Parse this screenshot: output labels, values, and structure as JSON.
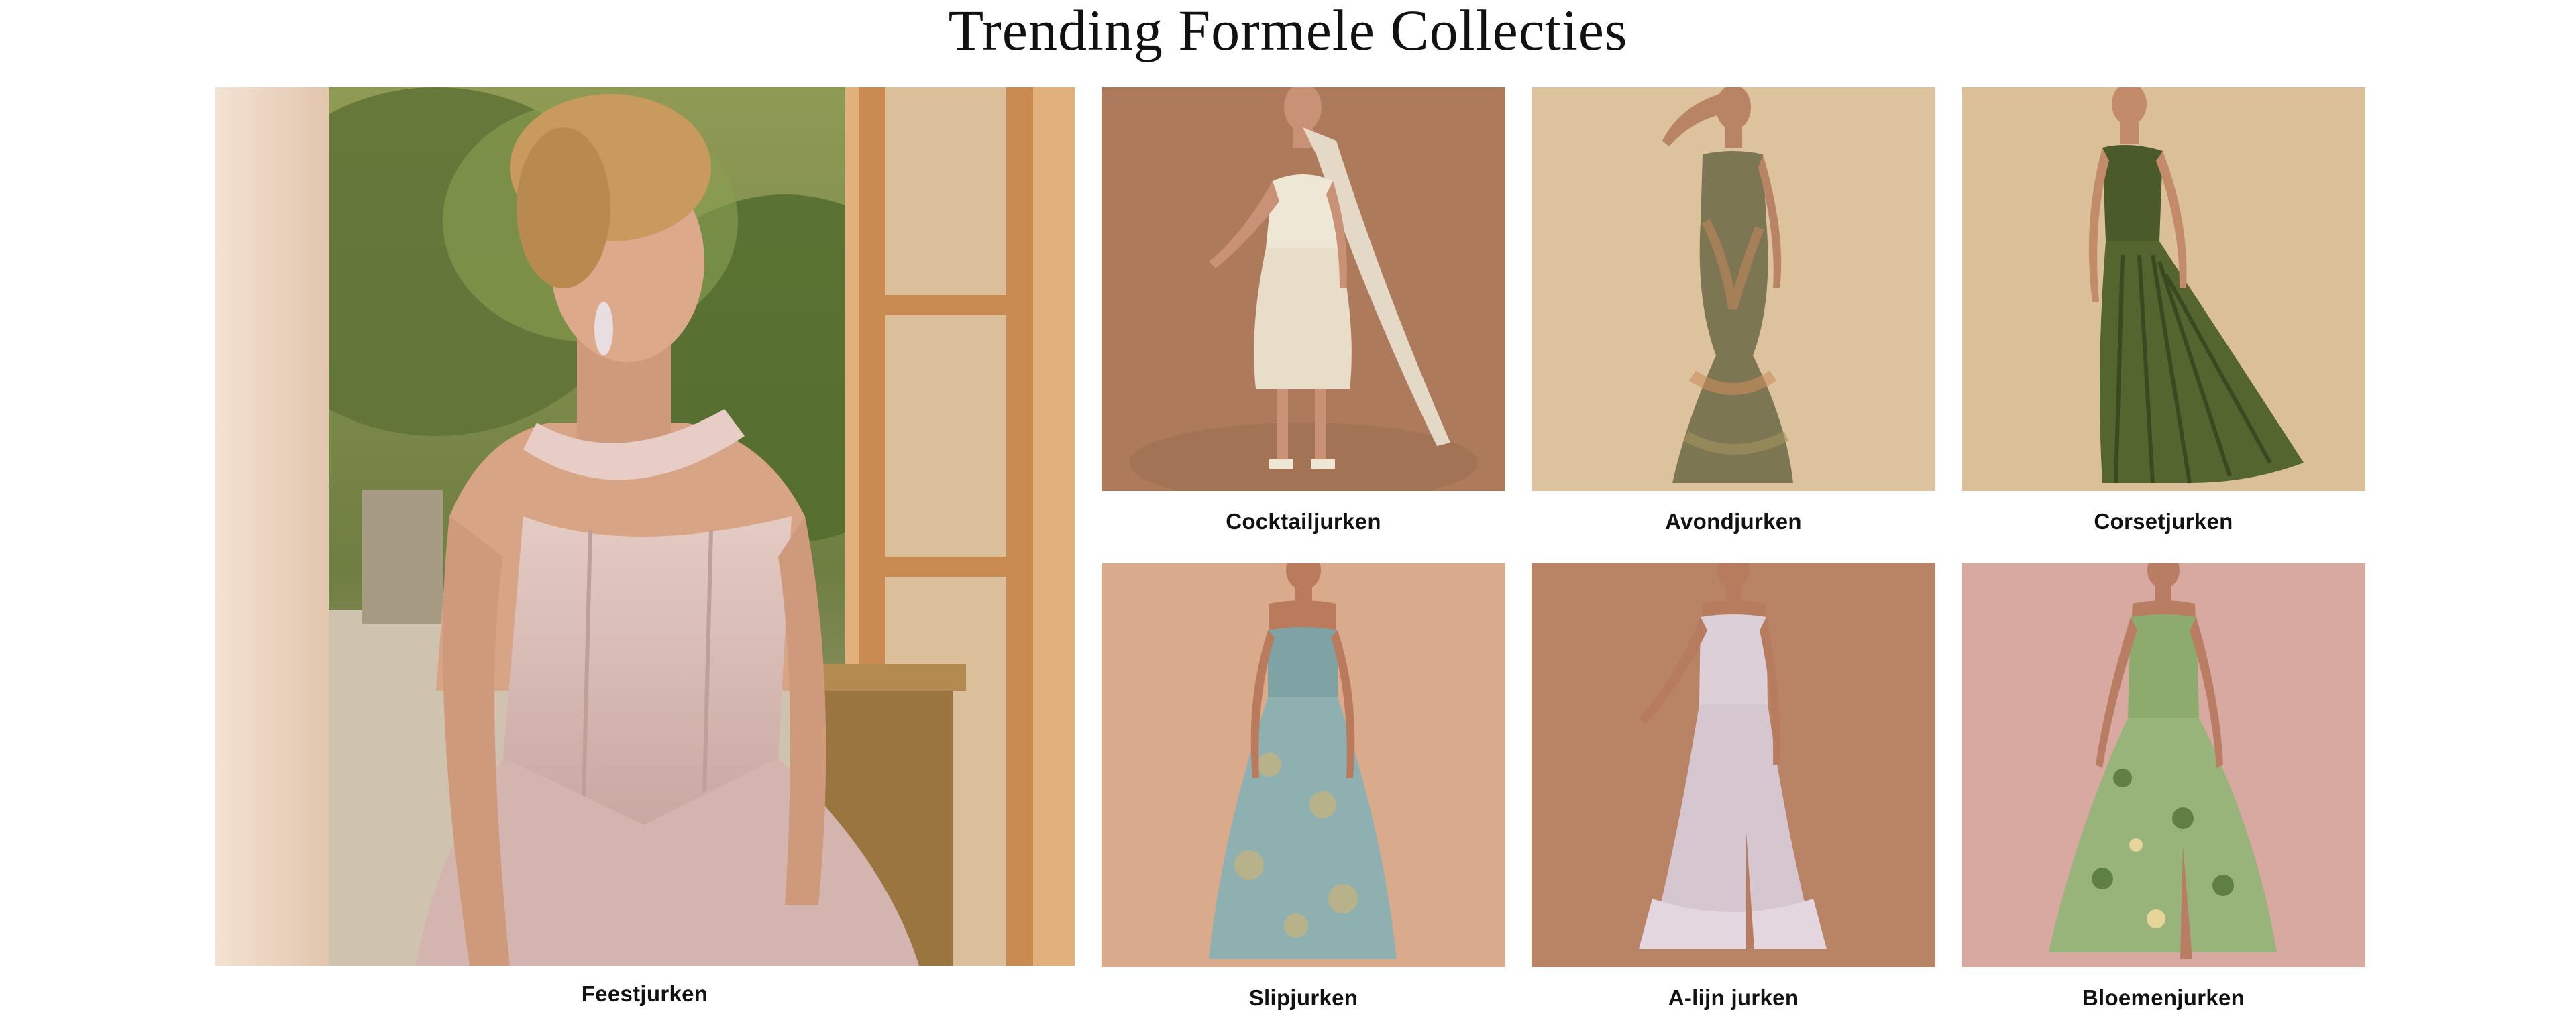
{
  "section": {
    "title": "Trending Formele Collecties"
  },
  "feature": {
    "label": "Feestjurken",
    "colors": {
      "dress": "#d9bcb6",
      "skin": "#d8a486",
      "hair": "#c89a5e",
      "garden": "#6f7e42",
      "window": "#c98b52"
    }
  },
  "collections": [
    {
      "label": "Cocktailjurken",
      "colors": {
        "bg": "#ad7b5c",
        "dress": "#efe7d6",
        "skin": "#c99175"
      }
    },
    {
      "label": "Avondjurken",
      "colors": {
        "bg": "#dcc39d",
        "dress": "#7d7652",
        "skin": "#b98366"
      }
    },
    {
      "label": "Corsetjurken",
      "colors": {
        "bg": "#dbbf98",
        "dress": "#4a5a2a",
        "skin": "#c28c6a"
      }
    },
    {
      "label": "Slipjurken",
      "colors": {
        "bg": "#d9ab8c",
        "dress": "#8fb0b0",
        "skin": "#b97b5c"
      }
    },
    {
      "label": "A-lijn jurken",
      "colors": {
        "bg": "#b98466",
        "dress": "#ddcfd7",
        "skin": "#b77c5e"
      }
    },
    {
      "label": "Bloemenjurken",
      "colors": {
        "bg": "#d7a9a1",
        "dress": "#8eab6e",
        "skin": "#b97d63"
      }
    }
  ]
}
